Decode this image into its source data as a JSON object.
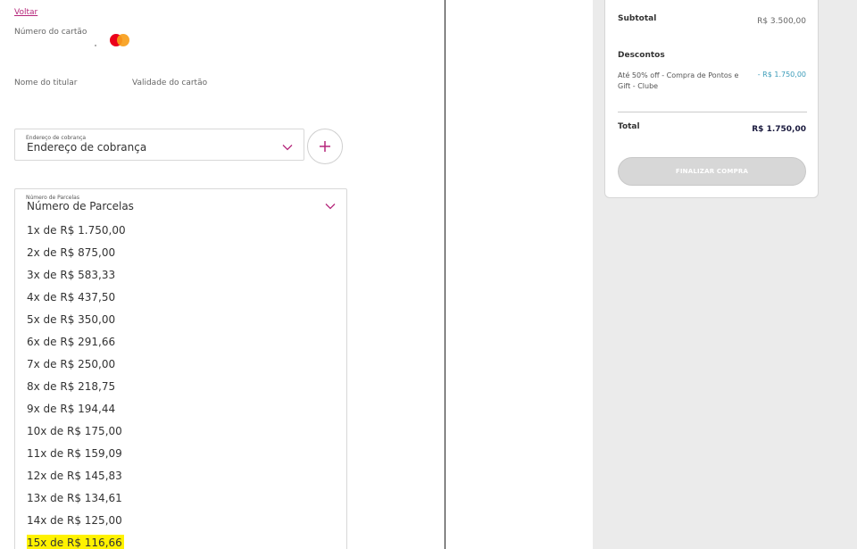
{
  "payment_form": {
    "back_link": "Voltar",
    "card_number_label": "Número do cartão",
    "card_brand_icon": "mastercard-icon",
    "holder_name_label": "Nome do titular",
    "expiry_label": "Validade do cartão",
    "billing_address": {
      "mini_label": "Endereço de cobrança",
      "selected_value": "Endereço de cobrança",
      "add_icon": "plus-icon"
    },
    "installments": {
      "mini_label": "Número de Parcelas",
      "selected_value": "Número de Parcelas",
      "options": [
        "1x de R$ 1.750,00",
        "2x de R$ 875,00",
        "3x de R$ 583,33",
        "4x de R$ 437,50",
        "5x de R$ 350,00",
        "6x de R$ 291,66",
        "7x de R$ 250,00",
        "8x de R$ 218,75",
        "9x de R$ 194,44",
        "10x de R$ 175,00",
        "11x de R$ 159,09",
        "12x de R$ 145,83",
        "13x de R$ 134,61",
        "14x de R$ 125,00",
        "15x de R$ 116,66"
      ],
      "highlighted_option": "15x de R$ 116,66"
    }
  },
  "order_summary": {
    "subtotal_label": "Subtotal",
    "subtotal_value": "R$ 3.500,00",
    "discounts_title": "Descontos",
    "discount_description": "Até 50% off - Compra de Pontos e Gift - Clube",
    "discount_value": "- R$ 1.750,00",
    "total_label": "Total",
    "total_value": "R$ 1.750,00",
    "finish_button": "FINALIZAR COMPRA"
  },
  "colors": {
    "accent": "#b5267b",
    "highlight": "#fff200",
    "discount": "#3a9bb8",
    "disabled_button": "#d7d7d7",
    "sidebar_bg": "#ebebeb"
  }
}
